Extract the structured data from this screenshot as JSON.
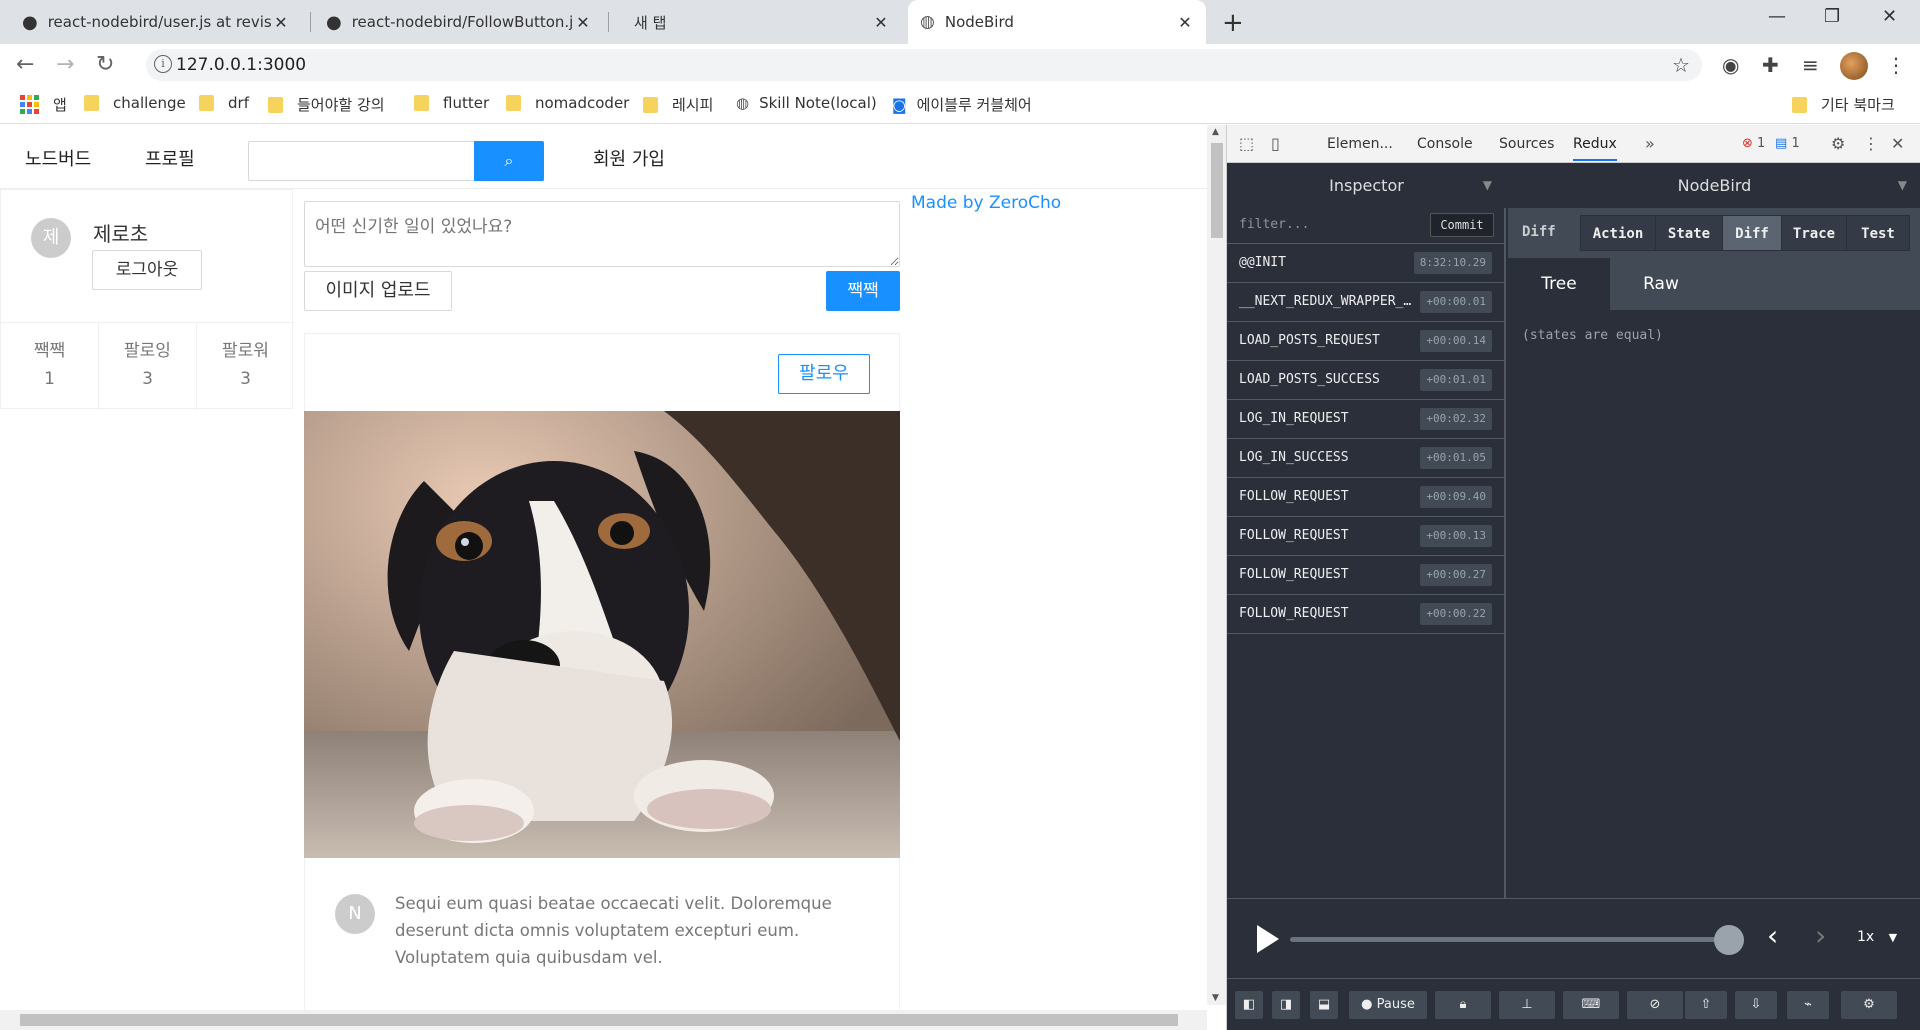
{
  "browser": {
    "tabs": [
      {
        "title": "react-nodebird/user.js at revised",
        "icon": "github-icon"
      },
      {
        "title": "react-nodebird/FollowButton.js",
        "icon": "github-icon"
      },
      {
        "title": "새 탭",
        "icon": ""
      },
      {
        "title": "NodeBird",
        "icon": "globe-icon"
      }
    ],
    "url": "127.0.0.1:3000",
    "bookmarks": [
      {
        "label": "앱",
        "type": "apps"
      },
      {
        "label": "challenge",
        "type": "folder"
      },
      {
        "label": "drf",
        "type": "folder"
      },
      {
        "label": "들어야할 강의",
        "type": "folder"
      },
      {
        "label": "flutter",
        "type": "folder"
      },
      {
        "label": "nomadcoder",
        "type": "folder"
      },
      {
        "label": "레시피",
        "type": "folder"
      },
      {
        "label": "Skill Note(local)",
        "type": "globe"
      },
      {
        "label": "에이블루 커블체어",
        "type": "site"
      },
      {
        "label": "기타 북마크",
        "type": "folder"
      }
    ]
  },
  "app": {
    "menu": {
      "home": "노드버드",
      "profile": "프로필",
      "signup": "회원 가입"
    },
    "search": {
      "placeholder": ""
    },
    "user": {
      "avatar_letter": "제",
      "name": "제로초",
      "logout": "로그아웃"
    },
    "stats": [
      {
        "label": "짹짹",
        "value": "1"
      },
      {
        "label": "팔로잉",
        "value": "3"
      },
      {
        "label": "팔로워",
        "value": "3"
      }
    ],
    "postform": {
      "placeholder": "어떤 신기한 일이 있었나요?",
      "upload": "이미지 업로드",
      "submit": "짹짹"
    },
    "madeby": "Made by ZeroCho",
    "post": {
      "follow": "팔로우",
      "avatar_letter": "N",
      "text": "Sequi eum quasi beatae occaecati velit. Doloremque deserunt dicta omnis voluptatem excepturi eum. Voluptatem quia quibusdam vel."
    }
  },
  "devtools": {
    "tabs": [
      "Elemen...",
      "Console",
      "Sources",
      "Redux"
    ],
    "active_tab": "Redux",
    "errors": "1",
    "messages": "1",
    "inspector_label": "Inspector",
    "store_label": "NodeBird",
    "filter_placeholder": "filter...",
    "commit": "Commit",
    "actions": [
      {
        "name": "@@INIT",
        "time": "8:32:10.29"
      },
      {
        "name": "__NEXT_REDUX_WRAPPER_HYDRATE__",
        "time": "+00:00.01"
      },
      {
        "name": "LOAD_POSTS_REQUEST",
        "time": "+00:00.14"
      },
      {
        "name": "LOAD_POSTS_SUCCESS",
        "time": "+00:01.01"
      },
      {
        "name": "LOG_IN_REQUEST",
        "time": "+00:02.32"
      },
      {
        "name": "LOG_IN_SUCCESS",
        "time": "+00:01.05"
      },
      {
        "name": "FOLLOW_REQUEST",
        "time": "+00:09.40"
      },
      {
        "name": "FOLLOW_REQUEST",
        "time": "+00:00.13"
      },
      {
        "name": "FOLLOW_REQUEST",
        "time": "+00:00.27"
      },
      {
        "name": "FOLLOW_REQUEST",
        "time": "+00:00.22"
      }
    ],
    "diff_label": "Diff",
    "view_buttons": [
      "Action",
      "State",
      "Diff",
      "Trace",
      "Test"
    ],
    "selected_view": "Diff",
    "tree_buttons": [
      "Tree",
      "Raw"
    ],
    "selected_tree": "Tree",
    "diff_message": "(states are equal)",
    "speed": "1x",
    "pause": "Pause"
  }
}
